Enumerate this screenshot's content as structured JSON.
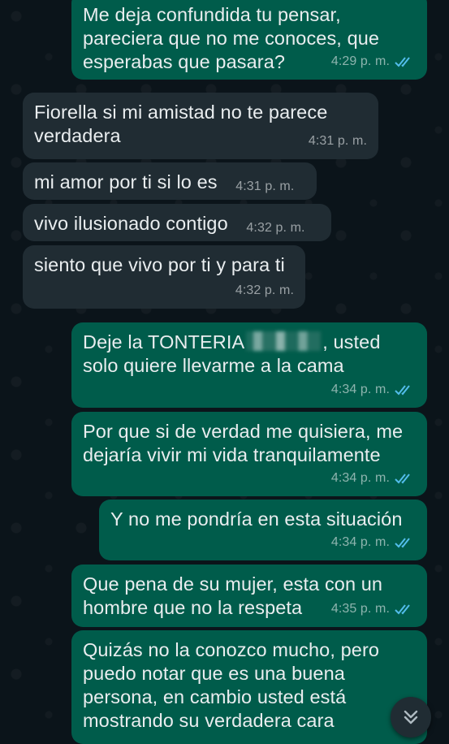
{
  "messages": [
    {
      "text": "Me deja confundida tu pensar,\npareciera que no me conoces, que\nesperabas que pasara?",
      "time": "4:29 p. m."
    },
    {
      "text": "Fiorella si mi amistad no te parece\nverdadera",
      "time": "4:31 p. m."
    },
    {
      "text": "mi amor por ti si lo es",
      "time": "4:31 p. m."
    },
    {
      "text": "vivo ilusionado contigo",
      "time": "4:32 p. m."
    },
    {
      "text": "siento que vivo por ti y para ti",
      "time": "4:32 p. m."
    },
    {
      "text_before": "Deje la TONTERIA",
      "text_after": ", usted\nsolo quiere llevarme a la cama",
      "time": "4:34 p. m."
    },
    {
      "text": "Por que si de verdad me quisiera, me\ndejaría vivir mi vida tranquilamente",
      "time": "4:34 p. m."
    },
    {
      "text": "Y no me pondría en esta situación",
      "time": "4:34 p. m."
    },
    {
      "text": "Que pena de su mujer, esta con un\nhombre que no la respeta",
      "time": "4:35 p. m."
    },
    {
      "text": "Quizás no la conozco mucho, pero\npuedo notar que es una buena\npersona, en cambio usted está\nmostrando su verdadera cara",
      "time": ""
    }
  ],
  "icons": {
    "read_receipt": "double-check-icon",
    "scroll_down": "double-chevron-down-icon"
  },
  "colors": {
    "background": "#0b141a",
    "incoming": "#202c33",
    "outgoing": "#005c4b",
    "read_tick": "#53bdeb"
  }
}
